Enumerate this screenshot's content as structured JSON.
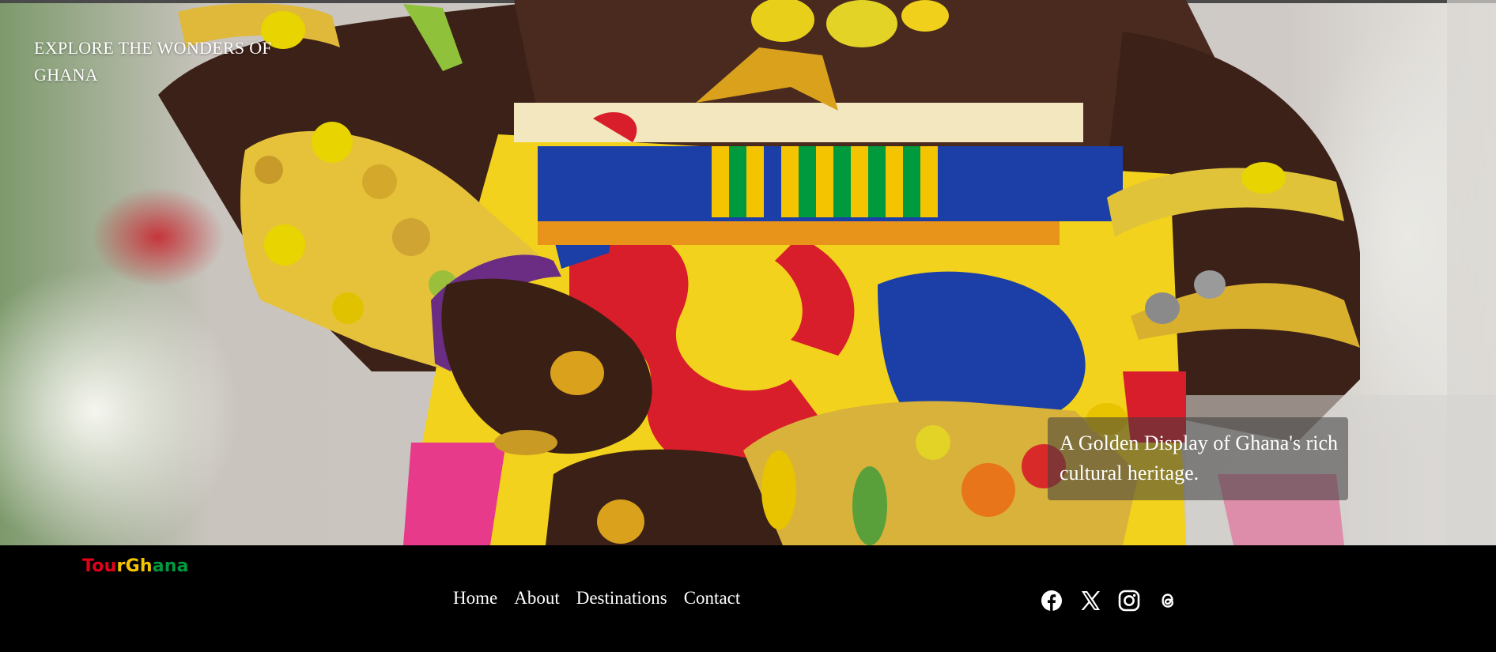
{
  "hero": {
    "title": "EXPLORE THE WONDERS OF GHANA",
    "caption": "A Golden Display of Ghana's rich cultural heritage.",
    "image_alt": "Woman wearing gold and bead bracelets with colorful kente cloth"
  },
  "brand": {
    "logo_letters": [
      {
        "char": "T",
        "color": "#e3001b"
      },
      {
        "char": "o",
        "color": "#e3001b"
      },
      {
        "char": "u",
        "color": "#e3001b"
      },
      {
        "char": "r",
        "color": "#f5c400"
      },
      {
        "char": "G",
        "color": "#f5c400"
      },
      {
        "char": "h",
        "color": "#f5c400"
      },
      {
        "char": "a",
        "color": "#009a3e"
      },
      {
        "char": "n",
        "color": "#009a3e"
      },
      {
        "char": "a",
        "color": "#009a3e"
      }
    ]
  },
  "nav": {
    "items": [
      {
        "label": "Home"
      },
      {
        "label": "About"
      },
      {
        "label": "Destinations"
      },
      {
        "label": "Contact"
      }
    ]
  },
  "social": {
    "icons": [
      "facebook-icon",
      "x-icon",
      "instagram-icon",
      "threads-icon"
    ]
  },
  "colors": {
    "footer_bg": "#000000",
    "text": "#ffffff"
  }
}
